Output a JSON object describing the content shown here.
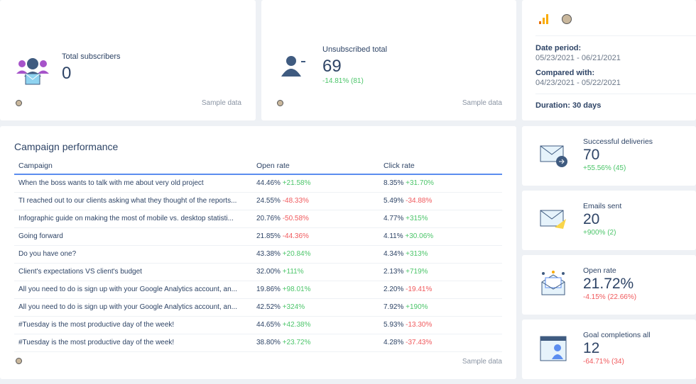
{
  "subscribers": {
    "label": "Total subscribers",
    "value": "0",
    "sample": "Sample data"
  },
  "unsubscribed": {
    "label": "Unsubscribed total",
    "value": "69",
    "change": "-14.81% (81)",
    "sample": "Sample data"
  },
  "info": {
    "date_label": "Date period:",
    "date_value": "05/23/2021 - 06/21/2021",
    "compared_label": "Compared with:",
    "compared_value": "04/23/2021 - 05/22/2021",
    "duration_label": "Duration:",
    "duration_value": "30 days"
  },
  "campaign": {
    "title": "Campaign performance",
    "headers": [
      "Campaign",
      "Open rate",
      "Click rate"
    ],
    "sample": "Sample data",
    "rows": [
      {
        "name": "When the boss wants to talk with me about very old project",
        "open": "44.46%",
        "open_ch": "+21.58%",
        "click": "8.35%",
        "click_ch": "+31.70%"
      },
      {
        "name": "TI reached out to our clients asking what they thought of the reports...",
        "open": "24.55%",
        "open_ch": "-48.33%",
        "click": "5.49%",
        "click_ch": "-34.88%"
      },
      {
        "name": "Infographic guide on making the most of mobile vs. desktop statisti...",
        "open": "20.76%",
        "open_ch": "-50.58%",
        "click": "4.77%",
        "click_ch": "+315%"
      },
      {
        "name": "Going forward",
        "open": "21.85%",
        "open_ch": "-44.36%",
        "click": "4.11%",
        "click_ch": "+30.06%"
      },
      {
        "name": "Do you have one?",
        "open": "43.38%",
        "open_ch": "+20.84%",
        "click": "4.34%",
        "click_ch": "+313%"
      },
      {
        "name": "Client's expectations VS client's budget",
        "open": "32.00%",
        "open_ch": "+111%",
        "click": "2.13%",
        "click_ch": "+719%"
      },
      {
        "name": "All you need to do is sign up with your Google Analytics account, an...",
        "open": "19.86%",
        "open_ch": "+98.01%",
        "click": "2.20%",
        "click_ch": "-19.41%"
      },
      {
        "name": "All you need to do is sign up with your Google Analytics account, an...",
        "open": "42.52%",
        "open_ch": "+324%",
        "click": "7.92%",
        "click_ch": "+190%"
      },
      {
        "name": "#Tuesday is the most productive day of the week!",
        "open": "44.65%",
        "open_ch": "+42.38%",
        "click": "5.93%",
        "click_ch": "-13.30%"
      },
      {
        "name": "#Tuesday is the most productive day of the week!",
        "open": "38.80%",
        "open_ch": "+23.72%",
        "click": "4.28%",
        "click_ch": "-37.43%"
      }
    ]
  },
  "kpis": [
    {
      "label": "Successful deliveries",
      "value": "70",
      "change": "+55.56% (45)",
      "dir": "up",
      "icon": "envelope-arrow-icon"
    },
    {
      "label": "Emails sent",
      "value": "20",
      "change": "+900% (2)",
      "dir": "up",
      "icon": "envelope-send-icon"
    },
    {
      "label": "Open rate",
      "value": "21.72%",
      "change": "-4.15% (22.66%)",
      "dir": "down",
      "icon": "open-envelope-icon"
    },
    {
      "label": "Goal completions all",
      "value": "12",
      "change": "-64.71% (34)",
      "dir": "down",
      "icon": "browser-user-icon"
    }
  ],
  "colors": {
    "positive": "#4cc56a",
    "negative": "#f0595c",
    "accent": "#5b8def"
  }
}
